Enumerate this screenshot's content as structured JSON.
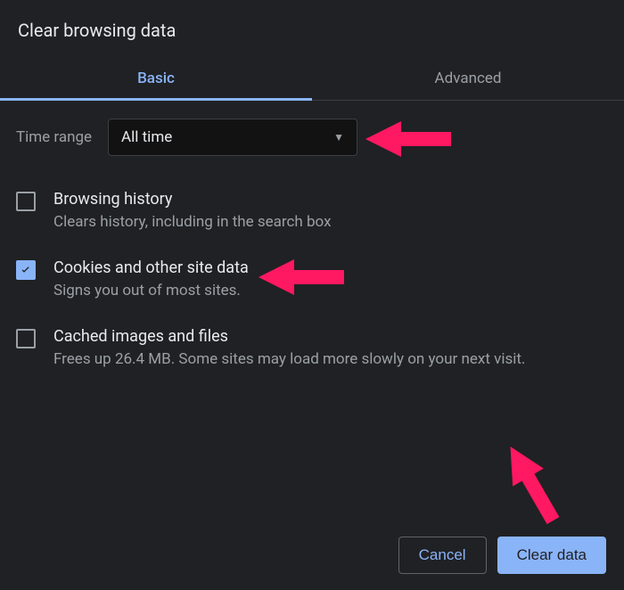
{
  "title": "Clear browsing data",
  "tabs": {
    "basic": "Basic",
    "advanced": "Advanced"
  },
  "timeRange": {
    "label": "Time range",
    "value": "All time"
  },
  "options": [
    {
      "title": "Browsing history",
      "desc": "Clears history, including in the search box",
      "checked": false
    },
    {
      "title": "Cookies and other site data",
      "desc": "Signs you out of most sites.",
      "checked": true
    },
    {
      "title": "Cached images and files",
      "desc": "Frees up 26.4 MB. Some sites may load more slowly on your next visit.",
      "checked": false
    }
  ],
  "buttons": {
    "cancel": "Cancel",
    "clear": "Clear data"
  },
  "colors": {
    "accent": "#8ab4f8",
    "arrow": "#ff1862"
  }
}
